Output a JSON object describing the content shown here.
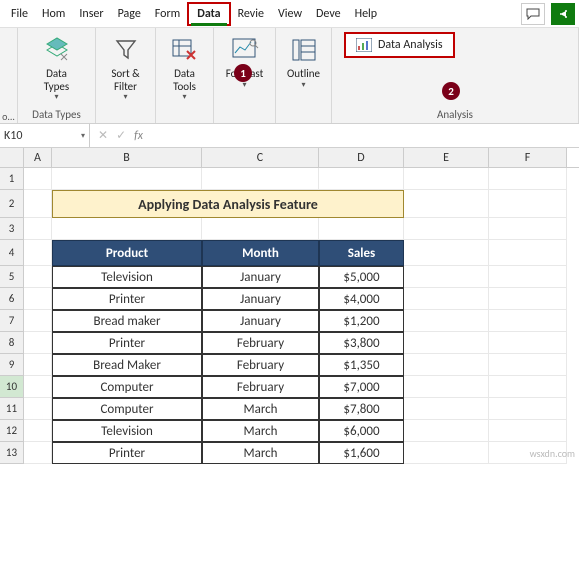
{
  "menu": {
    "tabs": [
      "File",
      "Hom",
      "Inser",
      "Page",
      "Form",
      "Data",
      "Revie",
      "View",
      "Deve",
      "Help"
    ],
    "active_index": 5
  },
  "ribbon": {
    "collapsed_left_label": "o...",
    "groups": {
      "data_types": {
        "btn": "Data\nTypes",
        "label": "Data Types"
      },
      "sort_filter": {
        "btn": "Sort &\nFilter"
      },
      "data_tools": {
        "btn": "Data\nTools"
      },
      "forecast": {
        "btn": "Forecast"
      },
      "outline": {
        "btn": "Outline"
      },
      "analysis": {
        "btn": "Data Analysis",
        "label": "Analysis"
      }
    },
    "badge1": "1",
    "badge2": "2"
  },
  "namebox": {
    "ref": "K10"
  },
  "formula_bar": {
    "fx": "fx",
    "value": ""
  },
  "columns": [
    "A",
    "B",
    "C",
    "D",
    "E",
    "F"
  ],
  "rows": [
    "1",
    "2",
    "3",
    "4",
    "5",
    "6",
    "7",
    "8",
    "9",
    "10",
    "11",
    "12",
    "13"
  ],
  "selected_row": "10",
  "title": "Applying Data Analysis Feature",
  "table": {
    "headers": {
      "product": "Product",
      "month": "Month",
      "sales": "Sales"
    },
    "rows": [
      {
        "product": "Television",
        "month": "January",
        "sales": "$5,000"
      },
      {
        "product": "Printer",
        "month": "January",
        "sales": "$4,000"
      },
      {
        "product": "Bread maker",
        "month": "January",
        "sales": "$1,200"
      },
      {
        "product": "Printer",
        "month": "February",
        "sales": "$3,800"
      },
      {
        "product": "Bread Maker",
        "month": "February",
        "sales": "$1,350"
      },
      {
        "product": "Computer",
        "month": "February",
        "sales": "$7,000"
      },
      {
        "product": "Computer",
        "month": "March",
        "sales": "$7,800"
      },
      {
        "product": "Television",
        "month": "March",
        "sales": "$6,000"
      },
      {
        "product": "Printer",
        "month": "March",
        "sales": "$1,600"
      }
    ]
  },
  "watermark": "wsxdn.com"
}
